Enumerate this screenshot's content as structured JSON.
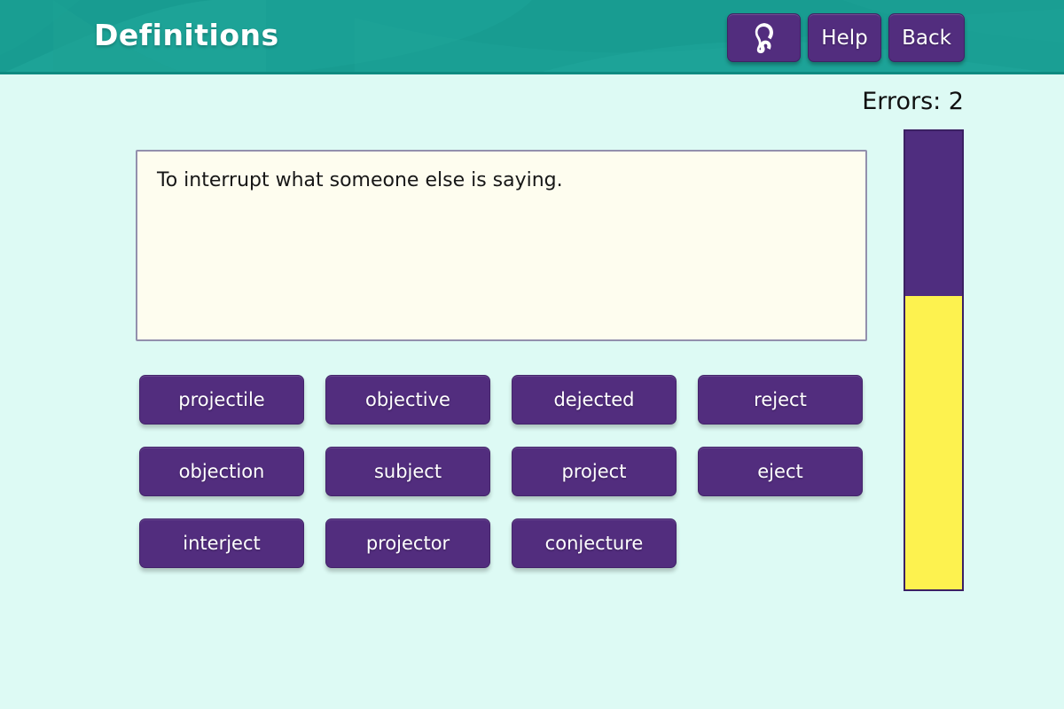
{
  "header": {
    "title": "Definitions",
    "background_color": "#189c91",
    "buttons": [
      {
        "name": "listen",
        "label": "",
        "icon": "ear-icon"
      },
      {
        "name": "help",
        "label": "Help",
        "icon": ""
      },
      {
        "name": "back",
        "label": "Back",
        "icon": ""
      }
    ]
  },
  "status": {
    "errors_label": "Errors: 2",
    "errors_count": 2
  },
  "progress": {
    "filled_percent": 36,
    "filled_color": "#4f2d7f",
    "remaining_color": "#fdf24f",
    "border_color": "#3b2063"
  },
  "definition": {
    "text": "To interrupt what someone else is saying.",
    "background_color": "#fefdef",
    "border_color": "#9390ad"
  },
  "answers": {
    "button_color": "#522d7e",
    "rows": [
      [
        {
          "label": "projectile"
        },
        {
          "label": "objective"
        },
        {
          "label": "dejected"
        },
        {
          "label": "reject"
        }
      ],
      [
        {
          "label": "objection"
        },
        {
          "label": "subject"
        },
        {
          "label": "project"
        },
        {
          "label": "eject"
        }
      ],
      [
        {
          "label": "interject"
        },
        {
          "label": "projector"
        },
        {
          "label": "conjecture"
        }
      ]
    ]
  },
  "page": {
    "background_color": "#ddfaf4"
  }
}
